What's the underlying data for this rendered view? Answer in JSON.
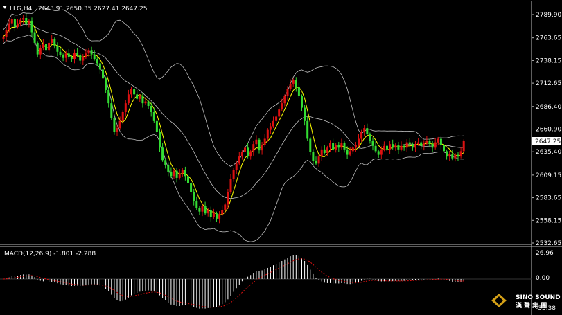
{
  "header": {
    "symbol": "LLG,H4",
    "ohlc": "2643.91 2650.35 2627.41 2647.25"
  },
  "price_axis": {
    "ticks": [
      "2789.90",
      "2763.65",
      "2738.15",
      "2712.65",
      "2686.40",
      "2660.90",
      "2635.40",
      "2609.15",
      "2583.65",
      "2558.15",
      "2532.65"
    ],
    "current": "2647.25"
  },
  "macd_panel": {
    "label": "MACD(12,26,9) -1.801 -2.288",
    "ticks": [
      "26.96",
      "0.00",
      "-33.38"
    ]
  },
  "logo": {
    "line1": "SINO SOUND",
    "line2": "漢 聲 集 團"
  },
  "colors": {
    "background": "#000000",
    "bull": "#dd1111",
    "bear": "#33dd33",
    "ma": "#ffff00",
    "bands": "#c0c0c0",
    "signal": "#dd1111",
    "hist": "#ffffff",
    "current_box": "#ffffff"
  },
  "chart_data": [
    {
      "type": "candlestick",
      "title": "LLG,H4",
      "ylim": [
        2532.65,
        2800
      ],
      "current_price": 2647.25,
      "indicators": [
        "Bollinger Bands",
        "Moving Average"
      ],
      "close": [
        2765,
        2772,
        2780,
        2785,
        2776,
        2780,
        2784,
        2786,
        2779,
        2783,
        2770,
        2758,
        2745,
        2752,
        2757,
        2750,
        2758,
        2762,
        2755,
        2748,
        2744,
        2741,
        2746,
        2742,
        2740,
        2747,
        2744,
        2738,
        2742,
        2746,
        2750,
        2745,
        2740,
        2735,
        2728,
        2718,
        2705,
        2690,
        2673,
        2658,
        2662,
        2670,
        2680,
        2690,
        2700,
        2706,
        2700,
        2695,
        2698,
        2690,
        2692,
        2687,
        2680,
        2670,
        2658,
        2640,
        2626,
        2620,
        2613,
        2608,
        2614,
        2606,
        2611,
        2615,
        2608,
        2600,
        2590,
        2580,
        2572,
        2568,
        2574,
        2566,
        2570,
        2562,
        2566,
        2560,
        2565,
        2570,
        2576,
        2590,
        2605,
        2615,
        2622,
        2630,
        2635,
        2640,
        2630,
        2636,
        2644,
        2649,
        2637,
        2643,
        2650,
        2660,
        2664,
        2670,
        2675,
        2683,
        2690,
        2698,
        2706,
        2712,
        2716,
        2708,
        2698,
        2685,
        2670,
        2650,
        2635,
        2625,
        2622,
        2630,
        2638,
        2634,
        2640,
        2645,
        2638,
        2643,
        2640,
        2645,
        2638,
        2632,
        2636,
        2640,
        2643,
        2650,
        2658,
        2662,
        2655,
        2648,
        2642,
        2636,
        2632,
        2638,
        2642,
        2638,
        2644,
        2640,
        2643,
        2638,
        2642,
        2640,
        2646,
        2644,
        2640,
        2644,
        2646,
        2642,
        2645,
        2648,
        2644,
        2640,
        2646,
        2650,
        2643,
        2636,
        2630,
        2633,
        2628,
        2632,
        2630,
        2636,
        2647.25
      ]
    },
    {
      "type": "bar",
      "title": "MACD(12,26,9)",
      "macd": -1.801,
      "signal": -2.288,
      "ylim": [
        -33.38,
        26.96
      ]
    }
  ]
}
